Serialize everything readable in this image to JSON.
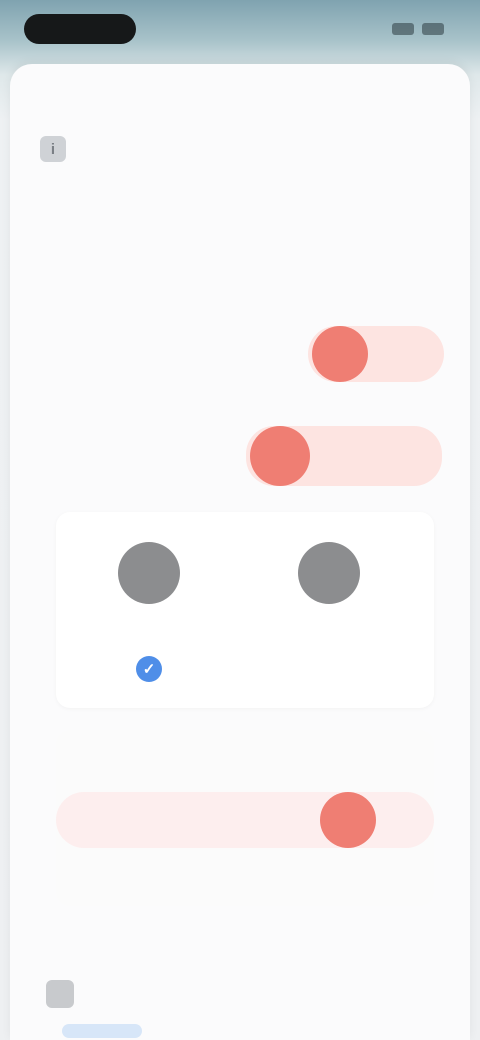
{
  "status_bar": {
    "time": "",
    "icons": [
      "signal-icon",
      "battery-icon"
    ]
  },
  "header": {
    "title": "",
    "action_label": ""
  },
  "notice": {
    "icon": "info-icon",
    "paragraph_1": "",
    "paragraph_2": "",
    "paragraph_3": ""
  },
  "rows": {
    "row1_label": "",
    "row1_value": "",
    "section_title": "",
    "row2_label": "",
    "row2_value": ""
  },
  "avatars": {
    "option_1_label": "",
    "option_2_label": "",
    "selected": 1
  },
  "group": {
    "title": "",
    "row_label": "",
    "footer": ""
  },
  "bottom": {
    "label": ""
  },
  "colors": {
    "accent_red": "#ef7e73",
    "accent_blue": "#4f8ee8",
    "track_pink": "#fde4e1"
  }
}
